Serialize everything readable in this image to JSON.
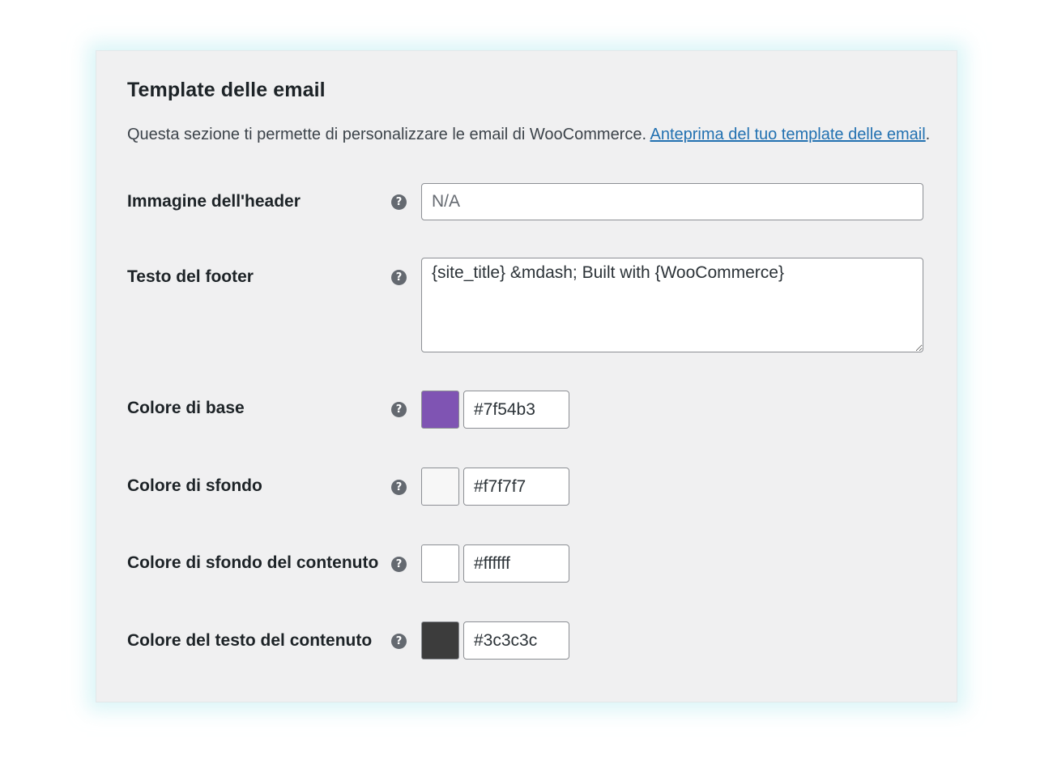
{
  "section": {
    "title": "Template delle email",
    "description": "Questa sezione ti permette di personalizzare le email di WooCommerce. ",
    "preview_link": "Anteprima del tuo template delle email",
    "description_end": "."
  },
  "fields": {
    "header_image": {
      "label": "Immagine dell'header",
      "placeholder": "N/A",
      "value": ""
    },
    "footer_text": {
      "label": "Testo del footer",
      "value": "{site_title} &mdash; Built with {WooCommerce}"
    },
    "base_color": {
      "label": "Colore di base",
      "value": "#7f54b3",
      "swatch": "#7f54b3"
    },
    "background_color": {
      "label": "Colore di sfondo",
      "value": "#f7f7f7",
      "swatch": "#f7f7f7"
    },
    "body_background_color": {
      "label": "Colore di sfondo del contenuto",
      "value": "#ffffff",
      "swatch": "#ffffff"
    },
    "body_text_color": {
      "label": "Colore del testo del contenuto",
      "value": "#3c3c3c",
      "swatch": "#3c3c3c"
    }
  },
  "icons": {
    "help": "help-icon",
    "help_glyph": "?"
  }
}
